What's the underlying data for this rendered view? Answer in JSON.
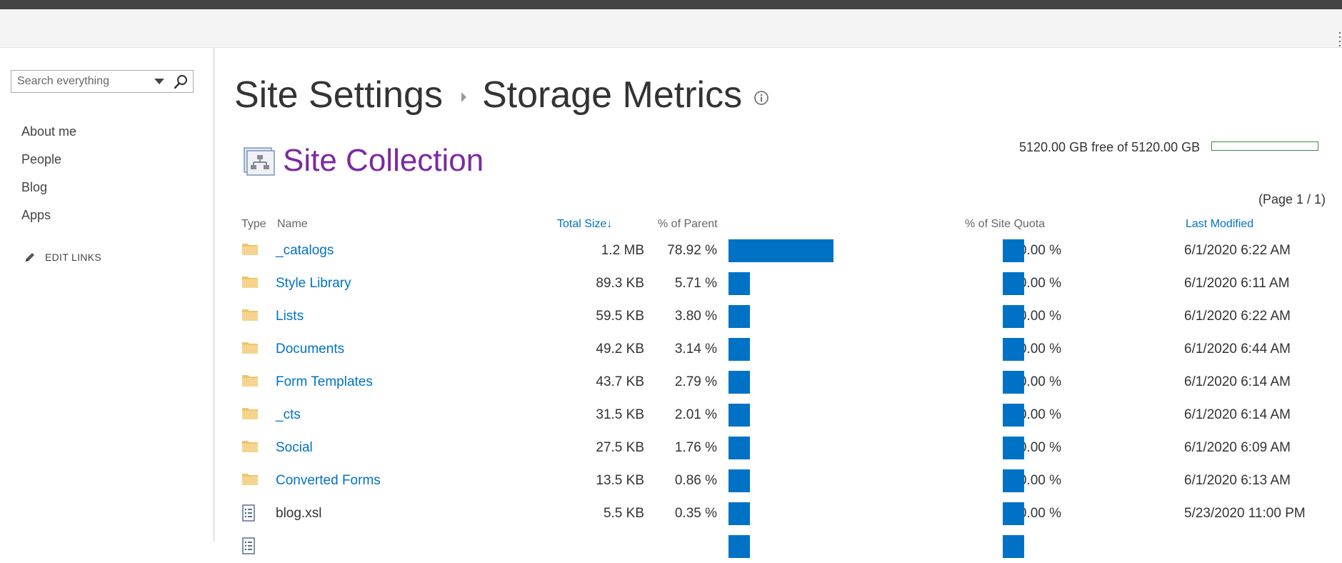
{
  "search": {
    "placeholder": "Search everything"
  },
  "leftnav": {
    "items": [
      {
        "label": "About me"
      },
      {
        "label": "People"
      },
      {
        "label": "Blog"
      },
      {
        "label": "Apps"
      }
    ],
    "edit_links_label": "EDIT LINKS"
  },
  "breadcrumb": {
    "parent": "Site Settings",
    "current": "Storage Metrics"
  },
  "section_title": "Site Collection",
  "quota": {
    "text": "5120.00 GB free of 5120.00 GB",
    "used_fraction": 0.0
  },
  "pager": "(Page 1 / 1)",
  "columns": {
    "type": "Type",
    "name": "Name",
    "total_size": "Total Size",
    "pct_parent": "% of Parent",
    "pct_quota": "% of Site Quota",
    "last_modified": "Last Modified"
  },
  "rows": [
    {
      "type": "folder",
      "name": "_catalogs",
      "size": "1.2 MB",
      "pct_parent": "78.92 %",
      "pct_parent_value": 78.92,
      "pct_quota": "0.00 %",
      "modified": "6/1/2020 6:22 AM"
    },
    {
      "type": "folder",
      "name": "Style Library",
      "size": "89.3 KB",
      "pct_parent": "5.71 %",
      "pct_parent_value": 5.71,
      "pct_quota": "0.00 %",
      "modified": "6/1/2020 6:11 AM"
    },
    {
      "type": "folder",
      "name": "Lists",
      "size": "59.5 KB",
      "pct_parent": "3.80 %",
      "pct_parent_value": 3.8,
      "pct_quota": "0.00 %",
      "modified": "6/1/2020 6:22 AM"
    },
    {
      "type": "folder",
      "name": "Documents",
      "size": "49.2 KB",
      "pct_parent": "3.14 %",
      "pct_parent_value": 3.14,
      "pct_quota": "0.00 %",
      "modified": "6/1/2020 6:44 AM"
    },
    {
      "type": "folder",
      "name": "Form Templates",
      "size": "43.7 KB",
      "pct_parent": "2.79 %",
      "pct_parent_value": 2.79,
      "pct_quota": "0.00 %",
      "modified": "6/1/2020 6:14 AM"
    },
    {
      "type": "folder",
      "name": "_cts",
      "size": "31.5 KB",
      "pct_parent": "2.01 %",
      "pct_parent_value": 2.01,
      "pct_quota": "0.00 %",
      "modified": "6/1/2020 6:14 AM"
    },
    {
      "type": "folder",
      "name": "Social",
      "size": "27.5 KB",
      "pct_parent": "1.76 %",
      "pct_parent_value": 1.76,
      "pct_quota": "0.00 %",
      "modified": "6/1/2020 6:09 AM"
    },
    {
      "type": "folder",
      "name": "Converted Forms",
      "size": "13.5 KB",
      "pct_parent": "0.86 %",
      "pct_parent_value": 0.86,
      "pct_quota": "0.00 %",
      "modified": "6/1/2020 6:13 AM"
    },
    {
      "type": "file",
      "name": "blog.xsl",
      "size": "5.5 KB",
      "pct_parent": "0.35 %",
      "pct_parent_value": 0.35,
      "pct_quota": "0.00 %",
      "modified": "5/23/2020 11:00 PM"
    },
    {
      "type": "file",
      "name": "",
      "size": "",
      "pct_parent": "",
      "pct_parent_value": 0.2,
      "pct_quota": "",
      "modified": ""
    }
  ]
}
